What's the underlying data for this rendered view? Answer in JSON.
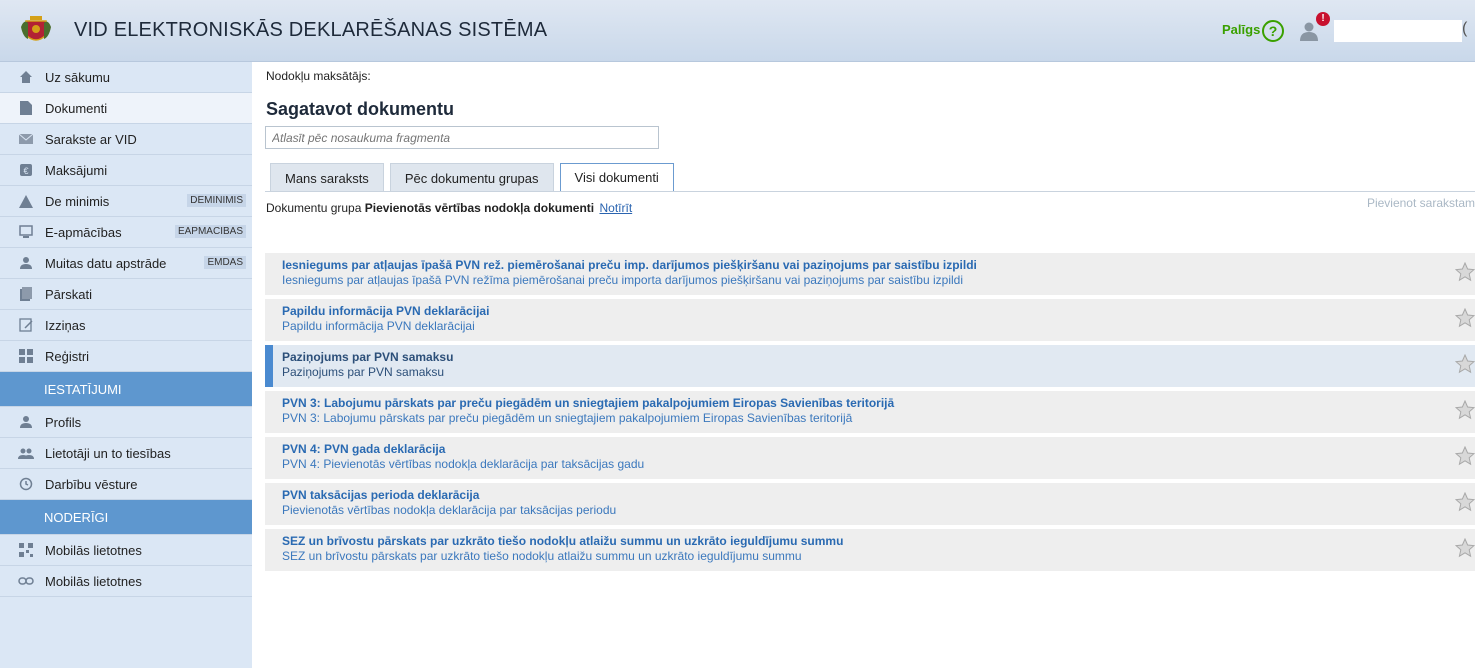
{
  "header": {
    "title": "VID ELEKTRONISKĀS DEKLARĒŠANAS SISTĒMA",
    "help_label": "Palīgs",
    "help_icon": "?",
    "notification_count": "!"
  },
  "sidebar": {
    "items": [
      {
        "label": "Uz sākumu",
        "icon": "home-icon"
      },
      {
        "label": "Dokumenti",
        "icon": "document-icon"
      },
      {
        "label": "Sarakste ar VID",
        "icon": "mail-icon"
      },
      {
        "label": "Maksājumi",
        "icon": "payment-icon"
      },
      {
        "label": "De minimis",
        "icon": "warning-icon",
        "tag": "DEMINIMIS"
      },
      {
        "label": "E-apmācības",
        "icon": "monitor-icon",
        "tag": "EAPMACIBAS"
      },
      {
        "label": "Muitas datu apstrāde",
        "icon": "customs-icon",
        "tag": "EMDAS"
      },
      {
        "label": "Pārskati",
        "icon": "reports-icon"
      },
      {
        "label": "Izziņas",
        "icon": "certificate-icon"
      },
      {
        "label": "Reģistri",
        "icon": "grid-icon"
      }
    ],
    "section_settings": "IESTATĪJUMI",
    "settings_items": [
      {
        "label": "Profils",
        "icon": "user-icon"
      },
      {
        "label": "Lietotāji un to tiesības",
        "icon": "users-icon"
      },
      {
        "label": "Darbību vēsture",
        "icon": "history-icon"
      }
    ],
    "section_useful": "NODERĪGI",
    "useful_items": [
      {
        "label": "Mobilās lietotnes",
        "icon": "qr-icon"
      },
      {
        "label": "Mobilās lietotnes",
        "icon": "link-icon"
      }
    ]
  },
  "main": {
    "payer_label": "Nodokļu maksātājs:",
    "title": "Sagatavot dokumentu",
    "search_placeholder": "Atlasīt pēc nosaukuma fragmenta",
    "tabs": [
      "Mans saraksts",
      "Pēc dokumentu grupas",
      "Visi dokumenti"
    ],
    "group_prefix": "Dokumentu grupa",
    "group_name": "Pievienotās vērtības nodokļa dokumenti",
    "clear_label": "Notīrīt",
    "add_to_list": "Pievienot sarakstam",
    "documents": [
      {
        "title": "Iesniegums par atļaujas īpašā PVN rež. piemērošanai preču imp. darījumos piešķiršanu vai paziņojums par saistību izpildi",
        "subtitle": "Iesniegums par atļaujas īpašā PVN režīma piemērošanai preču importa darījumos piešķiršanu vai paziņojums par saistību izpildi"
      },
      {
        "title": "Papildu informācija PVN deklarācijai",
        "subtitle": "Papildu informācija PVN deklarācijai"
      },
      {
        "title": "Paziņojums par PVN samaksu",
        "subtitle": "Paziņojums par PVN samaksu"
      },
      {
        "title": "PVN 3: Labojumu pārskats par preču piegādēm un sniegtajiem pakalpojumiem Eiropas Savienības teritorijā",
        "subtitle": "PVN 3: Labojumu pārskats par preču piegādēm un sniegtajiem pakalpojumiem Eiropas Savienības teritorijā"
      },
      {
        "title": "PVN 4: PVN gada deklarācija",
        "subtitle": "PVN 4: Pievienotās vērtības nodokļa deklarācija par taksācijas gadu"
      },
      {
        "title": "PVN taksācijas perioda deklarācija",
        "subtitle": "Pievienotās vērtības nodokļa deklarācija par taksācijas periodu"
      },
      {
        "title": "SEZ un brīvostu pārskats par uzkrāto tiešo nodokļu atlaižu summu un uzkrāto ieguldījumu summu",
        "subtitle": "SEZ un brīvostu pārskats par uzkrāto tiešo nodokļu atlaižu summu un uzkrāto ieguldījumu summu"
      }
    ]
  },
  "colors": {
    "accent": "#5e97cf",
    "sidebar_bg": "#dbe7f5",
    "link": "#2a6ab2",
    "help_green": "#3aa000"
  }
}
